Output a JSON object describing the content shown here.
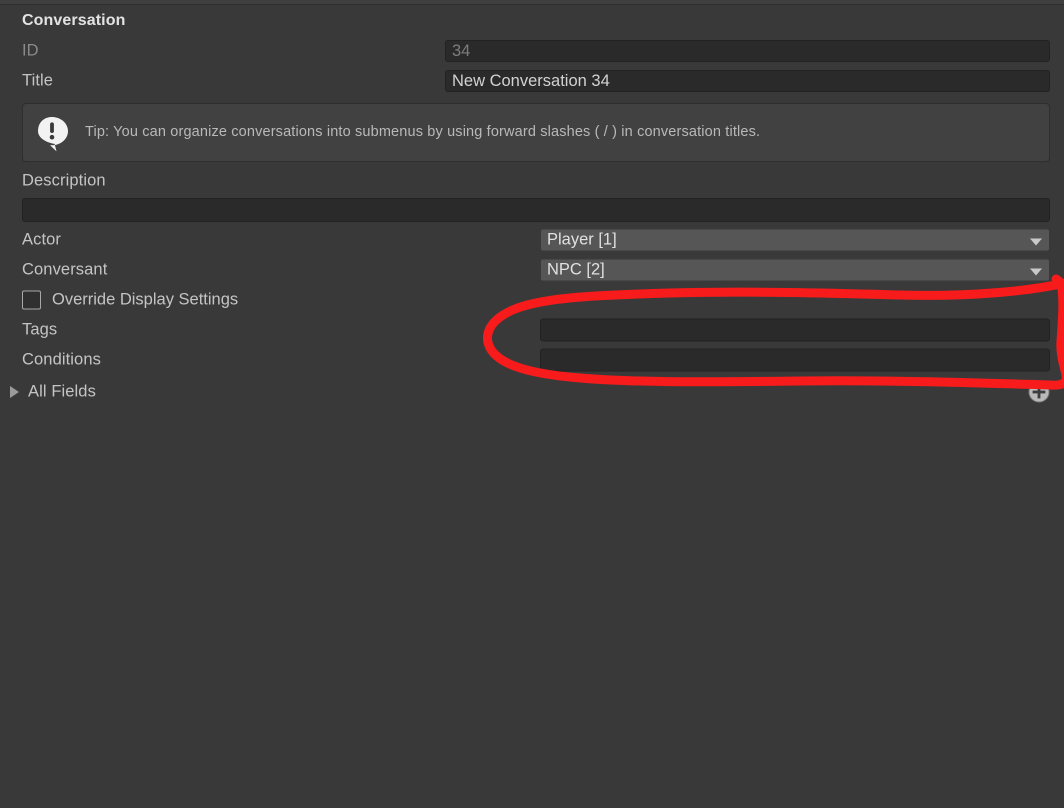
{
  "window": {
    "background_color": "#393939",
    "panel_title": "Conversation"
  },
  "inspector": {
    "header": {
      "label": "Conversation"
    },
    "fields": [
      {
        "name": "id",
        "label": "ID",
        "label_state": "disabled",
        "value": "34",
        "control": "text-readonly"
      },
      {
        "name": "title",
        "label": "Title",
        "label_state": "normal",
        "value": "New Conversation 34",
        "control": "text"
      }
    ],
    "tip": {
      "icon": "speech-bubble-exclamation-icon",
      "text": "Tip: You can organize conversations into submenus by using forward slashes ( / ) in conversation titles."
    },
    "description": {
      "label": "Description",
      "value": "",
      "placeholder": ""
    },
    "actor": {
      "label": "Actor",
      "value": "Player [1]",
      "control": "dropdown",
      "caret_icon": "chevron-down-icon"
    },
    "conversant": {
      "label": "Conversant",
      "value": "NPC [2]",
      "control": "dropdown",
      "caret_icon": "chevron-down-icon"
    },
    "override_display_settings": {
      "label": "Override Display Settings",
      "checked": false
    },
    "tags": {
      "label": "Tags",
      "value": ""
    },
    "conditions": {
      "label": "Conditions",
      "value": ""
    },
    "all_fields": {
      "label": "All Fields",
      "expanded": false,
      "foldout_icon": "triangle-right-icon",
      "add_button_icon": "plus-circle-icon"
    }
  },
  "annotation": {
    "type": "freehand-ellipse",
    "color": "#f71b1b",
    "stroke_width": 9,
    "targets": [
      "tags-field",
      "conditions-field"
    ]
  },
  "colors": {
    "background": "#393939",
    "field_background": "#2a2a2a",
    "popup_background": "#565656",
    "helpbox_background": "#414141",
    "label_text": "#c4c4c4",
    "disabled_text": "#8a8a8a",
    "annotation_red": "#f71b1b"
  }
}
